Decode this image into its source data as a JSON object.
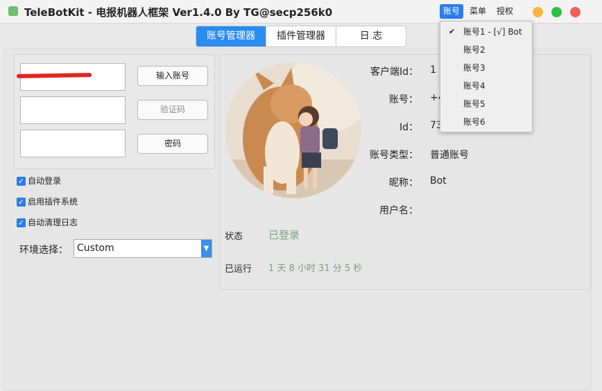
{
  "window": {
    "title": "TeleBotKit - 电报机器人框架 Ver1.4.0 By TG@secp256k0"
  },
  "menubar": {
    "items": [
      {
        "label": "账号"
      },
      {
        "label": "菜单"
      },
      {
        "label": "授权"
      }
    ]
  },
  "colors": {
    "accent": "#2b7de9",
    "status_text": "#7fa07f",
    "redaction": "#e0261f",
    "close": "#ee5f57",
    "minimize": "#f5b63d",
    "maximize": "#2fc145"
  },
  "tabs": [
    {
      "label": "账号管理器"
    },
    {
      "label": "插件管理器"
    },
    {
      "label": "日 志"
    }
  ],
  "login": {
    "account_input_value": "",
    "code_input_value": "",
    "password_input_value": "",
    "buttons": {
      "input_account": "输入账号",
      "code": "验证码",
      "password": "密码"
    }
  },
  "options": {
    "auto_login": "自动登录",
    "enable_plugins": "启用插件系统",
    "auto_clear_log": "自动清理日志"
  },
  "environment": {
    "label": "环境选择：",
    "selected": "Custom"
  },
  "profile": {
    "client_id_label": "客户端Id：",
    "client_id_value": "1",
    "account_label": "账号：",
    "account_value": "+4",
    "id_label": "Id：",
    "id_value": "73",
    "account_type_label": "账号类型：",
    "account_type_value": "普通账号",
    "nickname_label": "昵称：",
    "nickname_value": "Bot",
    "username_label": "用户名：",
    "username_value": ""
  },
  "status": {
    "status_label": "状态",
    "status_value": "已登录",
    "runtime_label": "已运行",
    "runtime_value": "1 天 8 小时 31 分 5 秒"
  },
  "dropdown": {
    "items": [
      {
        "label": "账号1 - [√] Bot",
        "checked": true,
        "check": "✔"
      },
      {
        "label": "账号2",
        "checked": false
      },
      {
        "label": "账号3",
        "checked": false
      },
      {
        "label": "账号4",
        "checked": false
      },
      {
        "label": "账号5",
        "checked": false
      },
      {
        "label": "账号6",
        "checked": false
      }
    ]
  }
}
